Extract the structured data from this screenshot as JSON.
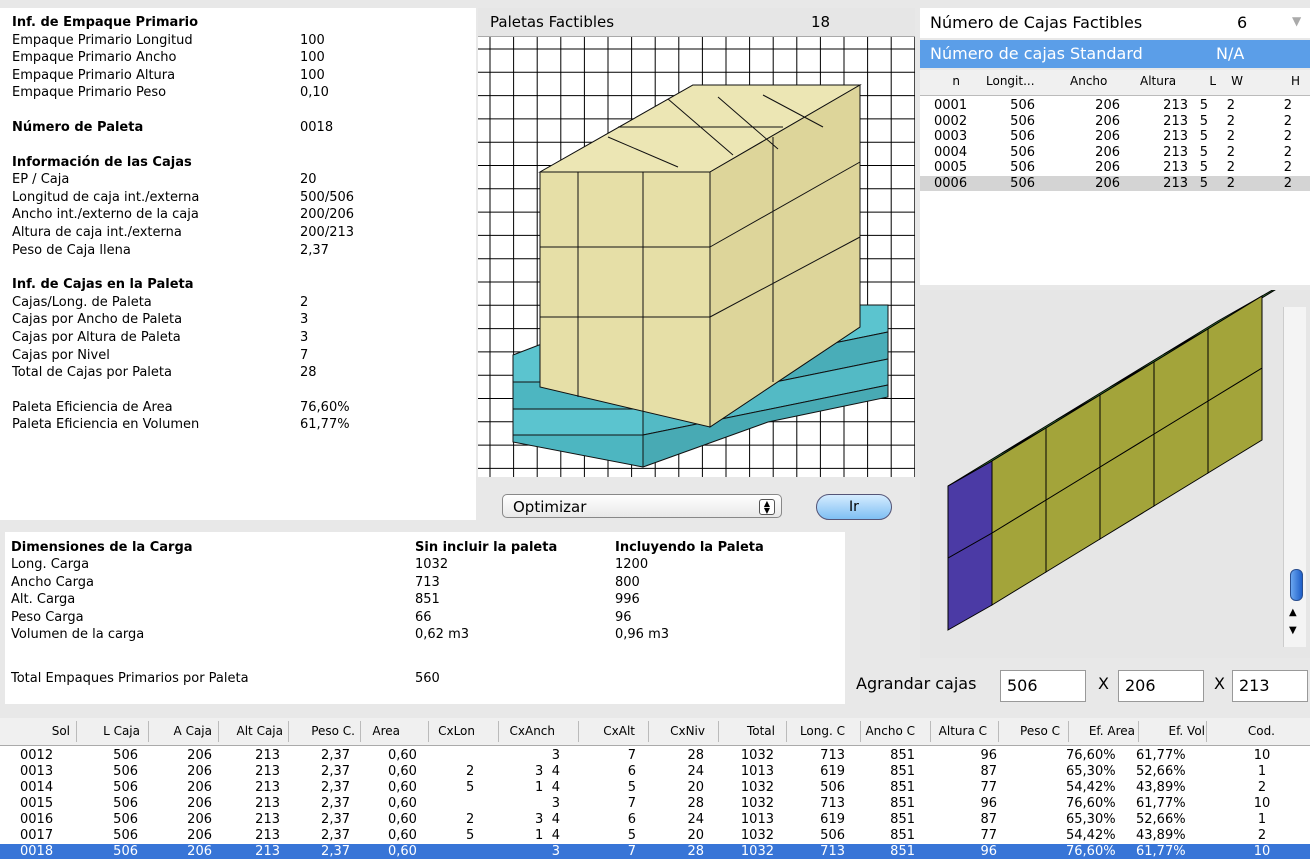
{
  "left_info": {
    "rows": [
      {
        "label": "Inf. de Empaque Primario",
        "value": "",
        "bold": true
      },
      {
        "label": "Empaque Primario Longitud",
        "value": "100"
      },
      {
        "label": "Empaque Primario Ancho",
        "value": "100"
      },
      {
        "label": "Empaque Primario Altura",
        "value": "100"
      },
      {
        "label": "Empaque Primario Peso",
        "value": "0,10"
      },
      {
        "label": "Número de Paleta",
        "value": "0018",
        "bold": true,
        "gap": true
      },
      {
        "label": "Información de las Cajas",
        "value": "",
        "bold": true,
        "gap": true
      },
      {
        "label": "EP / Caja",
        "value": "20"
      },
      {
        "label": "Longitud de caja int./externa",
        "value": "500/506"
      },
      {
        "label": "Ancho int./externo de la caja",
        "value": "200/206"
      },
      {
        "label": "Altura de caja int./externa",
        "value": "200/213"
      },
      {
        "label": "Peso de Caja llena",
        "value": "2,37"
      },
      {
        "label": "Inf. de Cajas en la Paleta",
        "value": "",
        "bold": true,
        "gap": true
      },
      {
        "label": "Cajas/Long. de Paleta",
        "value": "2"
      },
      {
        "label": "Cajas por Ancho de Paleta",
        "value": "3"
      },
      {
        "label": "Cajas por Altura de Paleta",
        "value": "3"
      },
      {
        "label": "Cajas por Nivel",
        "value": "7"
      },
      {
        "label": "Total de Cajas por Paleta",
        "value": "28"
      },
      {
        "label": "Paleta Eficiencia de Area",
        "value": "76,60%",
        "gap": true
      },
      {
        "label": "Paleta Eficiencia en Volumen",
        "value": "61,77%"
      }
    ]
  },
  "pallets": {
    "label": "Paletas Factibles",
    "count": "18"
  },
  "controls": {
    "select_value": "Optimizar",
    "go_label": "Ir"
  },
  "boxes": {
    "title": "Número de Cajas Factibles",
    "count": "6",
    "standard_label": "Número de cajas Standard",
    "standard_value": "N/A",
    "columns": [
      "n",
      "Longit...",
      "Ancho",
      "Altura",
      "L",
      "W",
      "H"
    ],
    "rows": [
      [
        "0001",
        "506",
        "206",
        "213",
        "5",
        "2",
        "2"
      ],
      [
        "0002",
        "506",
        "206",
        "213",
        "5",
        "2",
        "2"
      ],
      [
        "0003",
        "506",
        "206",
        "213",
        "5",
        "2",
        "2"
      ],
      [
        "0004",
        "506",
        "206",
        "213",
        "5",
        "2",
        "2"
      ],
      [
        "0005",
        "506",
        "206",
        "213",
        "5",
        "2",
        "2"
      ],
      [
        "0006",
        "506",
        "206",
        "213",
        "5",
        "2",
        "2"
      ]
    ],
    "selected_row": 5
  },
  "load": {
    "title": "Dimensiones de la Carga",
    "col1": "Sin incluir la paleta",
    "col2": "Incluyendo la Paleta",
    "rows": [
      [
        "Long. Carga",
        "1032",
        "1200"
      ],
      [
        "Ancho Carga",
        "713",
        "800"
      ],
      [
        "Alt. Carga",
        "851",
        "996"
      ],
      [
        "Peso Carga",
        "66",
        "96"
      ],
      [
        "Volumen de la carga",
        "0,62 m3",
        "0,96 m3"
      ]
    ],
    "total_label": "Total Empaques Primarios por Paleta",
    "total_value": "560"
  },
  "enlarge": {
    "label": "Agrandar cajas",
    "x": "X",
    "v1": "506",
    "v2": "206",
    "v3": "213"
  },
  "solutions": {
    "columns": [
      "Sol",
      "L Caja",
      "A Caja",
      "Alt Caja",
      "Peso C.",
      "Area",
      "CxLon",
      "CxAnch",
      "CxAlt",
      "CxNiv",
      "Total",
      "Long. C",
      "Ancho C",
      "Altura C",
      "Peso C",
      "Ef. Area",
      "Ef. Vol",
      "Cod."
    ],
    "rows": [
      [
        "0012",
        "506",
        "206",
        "213",
        "2,37",
        "0,60",
        "",
        "",
        "3",
        "7",
        "28",
        "1032",
        "713",
        "851",
        "96",
        "76,60%",
        "61,77%",
        "10"
      ],
      [
        "0013",
        "506",
        "206",
        "213",
        "2,37",
        "0,60",
        "2",
        "3",
        "4",
        "6",
        "24",
        "1013",
        "619",
        "851",
        "87",
        "65,30%",
        "52,66%",
        "1"
      ],
      [
        "0014",
        "506",
        "206",
        "213",
        "2,37",
        "0,60",
        "5",
        "1",
        "4",
        "5",
        "20",
        "1032",
        "506",
        "851",
        "77",
        "54,42%",
        "43,89%",
        "2"
      ],
      [
        "0015",
        "506",
        "206",
        "213",
        "2,37",
        "0,60",
        "",
        "",
        "3",
        "7",
        "28",
        "1032",
        "713",
        "851",
        "96",
        "76,60%",
        "61,77%",
        "10"
      ],
      [
        "0016",
        "506",
        "206",
        "213",
        "2,37",
        "0,60",
        "2",
        "3",
        "4",
        "6",
        "24",
        "1013",
        "619",
        "851",
        "87",
        "65,30%",
        "52,66%",
        "1"
      ],
      [
        "0017",
        "506",
        "206",
        "213",
        "2,37",
        "0,60",
        "5",
        "1",
        "4",
        "5",
        "20",
        "1032",
        "506",
        "851",
        "77",
        "54,42%",
        "43,89%",
        "2"
      ],
      [
        "0018",
        "506",
        "206",
        "213",
        "2,37",
        "0,60",
        "",
        "",
        "3",
        "7",
        "28",
        "1032",
        "713",
        "851",
        "96",
        "76,60%",
        "61,77%",
        "10"
      ]
    ],
    "selected_row": 6
  },
  "colors": {
    "box_face": "#e6dfa7",
    "pallet": "#5bc4cf",
    "green_top": "#3a8a3a",
    "olive_side": "#a3a43a",
    "purple_end": "#4b3aa5",
    "selection": "#3875d7",
    "standard_bar": "#5b9ee8"
  },
  "icons": [
    "select-arrows-icon",
    "scroll-up-icon",
    "scroll-down-icon",
    "dropdown-indicator-icon"
  ]
}
